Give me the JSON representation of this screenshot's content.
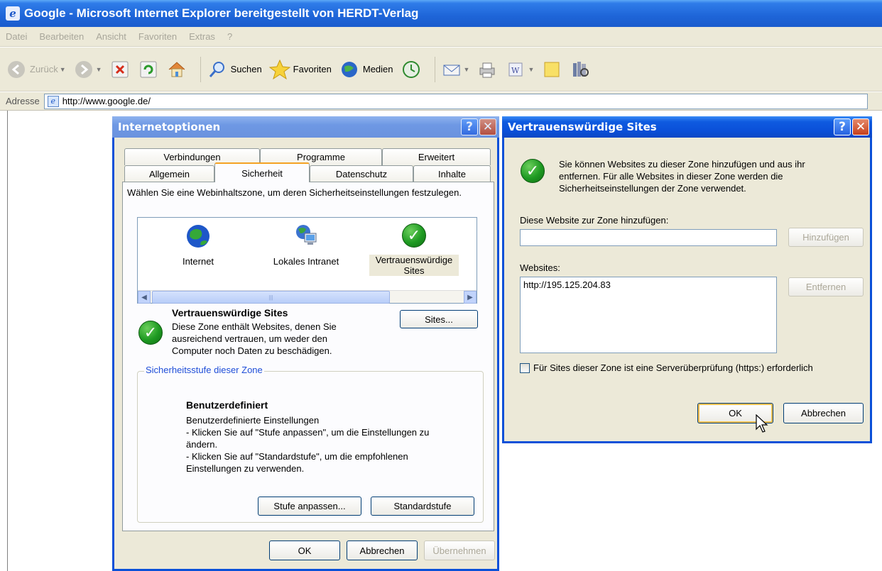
{
  "window": {
    "title": "Google - Microsoft Internet Explorer bereitgestellt von HERDT-Verlag"
  },
  "menubar": [
    "Datei",
    "Bearbeiten",
    "Ansicht",
    "Favoriten",
    "Extras",
    "?"
  ],
  "toolbar": {
    "back_label": "Zurück",
    "search_label": "Suchen",
    "favorites_label": "Favoriten",
    "media_label": "Medien"
  },
  "address": {
    "label": "Adresse",
    "url": "http://www.google.de/"
  },
  "internet_options": {
    "title": "Internetoptionen",
    "tabs_row1": [
      "Verbindungen",
      "Programme",
      "Erweitert"
    ],
    "tabs_row2": [
      "Allgemein",
      "Sicherheit",
      "Datenschutz",
      "Inhalte"
    ],
    "active_tab": "Sicherheit",
    "intro": "Wählen Sie eine Webinhaltszone, um deren Sicherheitseinstellungen festzulegen.",
    "zones": [
      {
        "label": "Internet"
      },
      {
        "label": "Lokales Intranet"
      },
      {
        "label": "Vertrauenswürdige Sites"
      }
    ],
    "zone_heading": "Vertrauenswürdige Sites",
    "zone_description": "Diese Zone enthält Websites, denen Sie ausreichend vertrauen, um weder den Computer noch Daten zu beschädigen.",
    "sites_button": "Sites...",
    "security_group_label": "Sicherheitsstufe dieser Zone",
    "level_heading": "Benutzerdefiniert",
    "level_lines": [
      "Benutzerdefinierte Einstellungen",
      "- Klicken Sie auf \"Stufe anpassen\", um die Einstellungen zu ändern.",
      "- Klicken Sie auf \"Standardstufe\", um die empfohlenen Einstellungen zu verwenden."
    ],
    "custom_level_button": "Stufe anpassen...",
    "default_level_button": "Standardstufe",
    "ok_button": "OK",
    "cancel_button": "Abbrechen",
    "apply_button": "Übernehmen"
  },
  "trusted_sites": {
    "title": "Vertrauenswürdige Sites",
    "info": "Sie können Websites zu dieser Zone hinzufügen und aus ihr entfernen. Für alle Websites in dieser Zone werden die Sicherheitseinstellungen der Zone verwendet.",
    "add_label": "Diese Website zur Zone hinzufügen:",
    "add_input_value": "",
    "add_button": "Hinzufügen",
    "websites_label": "Websites:",
    "websites": [
      "http://195.125.204.83"
    ],
    "remove_button": "Entfernen",
    "https_checkbox_label": "Für Sites dieser Zone ist eine Serverüberprüfung (https:) erforderlich",
    "https_checked": false,
    "ok_button": "OK",
    "cancel_button": "Abbrechen"
  }
}
